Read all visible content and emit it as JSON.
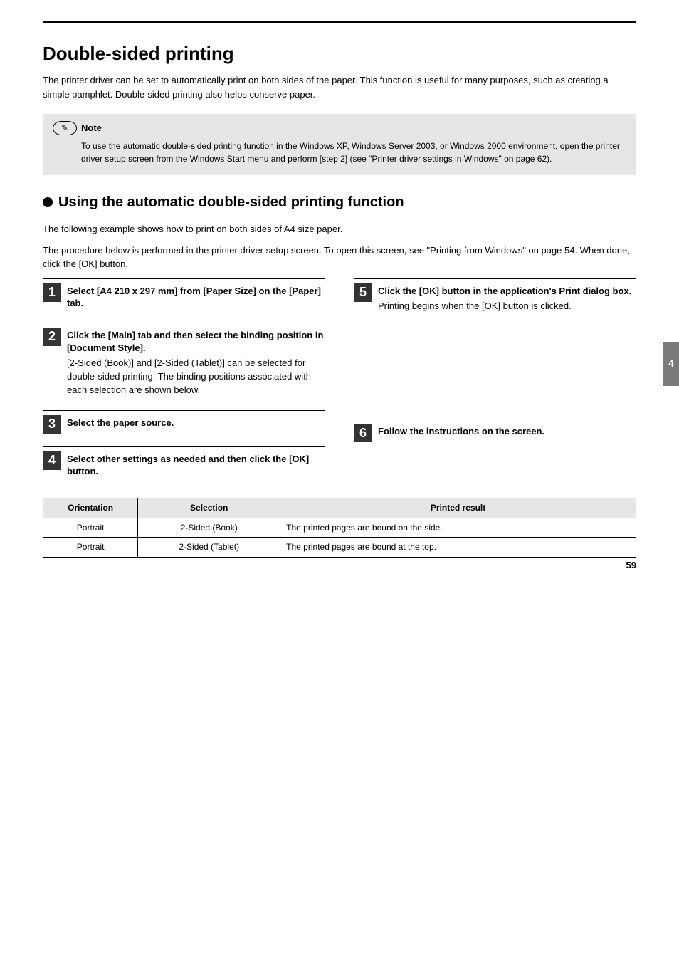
{
  "page": {
    "title": "Double-sided printing",
    "intro": "The printer driver can be set to automatically print on both sides of the paper. This function is useful for many purposes, such as creating a simple pamphlet. Double-sided printing also helps conserve paper.",
    "note": {
      "title": "Note",
      "body": "To use the automatic double-sided printing function in the Windows XP, Windows Server 2003, or Windows 2000 environment, open the printer driver setup screen from the Windows Start menu and perform [step 2] (see \"Printer driver settings in Windows\" on page 62)."
    },
    "procedure": {
      "heading": "Using the automatic double-sided printing function",
      "intro1": "The following example shows how to print on both sides of A4 size paper.",
      "intro2": "The procedure below is performed in the printer driver setup screen. To open this screen, see \"Printing from Windows\" on page 54. When done, click the [OK] button."
    },
    "steps": [
      {
        "num": "1",
        "title": "Select [A4 210 x 297 mm] from [Paper Size] on the [Paper] tab.",
        "desc": ""
      },
      {
        "num": "2",
        "title": "Click the [Main] tab and then select the binding position in [Document Style].",
        "desc": "[2-Sided (Book)] and [2-Sided (Tablet)] can be selected for double-sided printing. The binding positions associated with each selection are shown below."
      },
      {
        "num": "3",
        "title": "Select the paper source.",
        "desc": ""
      },
      {
        "num": "4",
        "title": "Select other settings as needed and then click the [OK] button.",
        "desc": ""
      },
      {
        "num": "5",
        "title": "Click the [OK] button in the application's Print dialog box.",
        "desc": "Printing begins when the [OK] button is clicked."
      },
      {
        "num": "6",
        "title": "Follow the instructions on the screen.",
        "desc": ""
      }
    ],
    "table": {
      "headers": [
        "Orientation",
        "Selection",
        "Printed result"
      ],
      "rows": [
        {
          "orientation": "Portrait",
          "selection": "2-Sided (Book)",
          "result": "The printed pages are bound on the side."
        },
        {
          "orientation": "Portrait",
          "selection": "2-Sided (Tablet)",
          "result": "The printed pages are bound at the top."
        }
      ]
    },
    "sideTab": "4",
    "pageNumber": "59"
  }
}
